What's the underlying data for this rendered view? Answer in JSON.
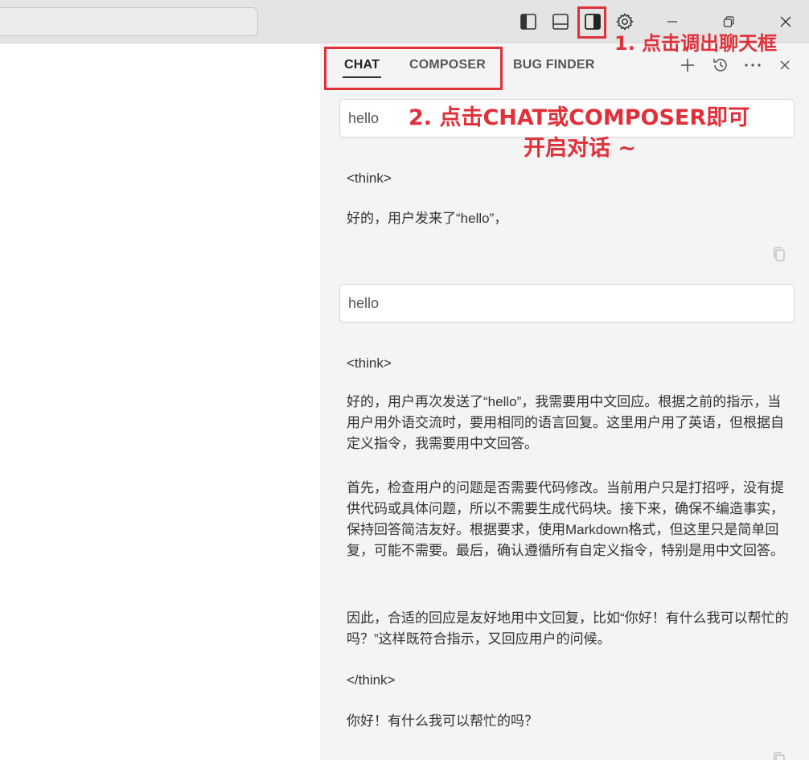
{
  "panel": {
    "tabs": [
      {
        "label": "CHAT",
        "active": true
      },
      {
        "label": "COMPOSER",
        "active": false
      },
      {
        "label": "BUG FINDER",
        "active": false
      }
    ],
    "conversation": [
      {
        "user": "hello",
        "response": [
          "<think>",
          "好的，用户发来了“hello”，"
        ]
      },
      {
        "user": "hello",
        "response": [
          "<think>",
          "好的，用户再次发送了“hello”，我需要用中文回应。根据之前的指示，当用户用外语交流时，要用相同的语言回复。这里用户用了英语，但根据自定义指令，我需要用中文回答。",
          "首先，检查用户的问题是否需要代码修改。当前用户只是打招呼，没有提供代码或具体问题，所以不需要生成代码块。接下来，确保不编造事实，保持回答简洁友好。根据要求，使用Markdown格式，但这里只是简单回复，可能不需要。最后，确认遵循所有自定义指令，特别是用中文回答。",
          "因此，合适的回应是友好地用中文回复，比如“你好！有什么我可以帮忙的吗？”这样既符合指示，又回应用户的问候。",
          "</think>",
          "你好！有什么我可以帮忙的吗？"
        ]
      }
    ]
  },
  "annotations": {
    "step1": "1. 点击调出聊天框",
    "step2_line1": "2. 点击CHAT或COMPOSER即可",
    "step2_line2": "开启对话 ~",
    "color": "#e0303a"
  },
  "icons": [
    "toggle-primary-sidebar-icon",
    "toggle-panel-icon",
    "toggle-secondary-sidebar-icon",
    "gear-icon",
    "minimize-icon",
    "restore-icon",
    "close-icon",
    "plus-icon",
    "history-icon",
    "more-icon",
    "copy-icon"
  ]
}
